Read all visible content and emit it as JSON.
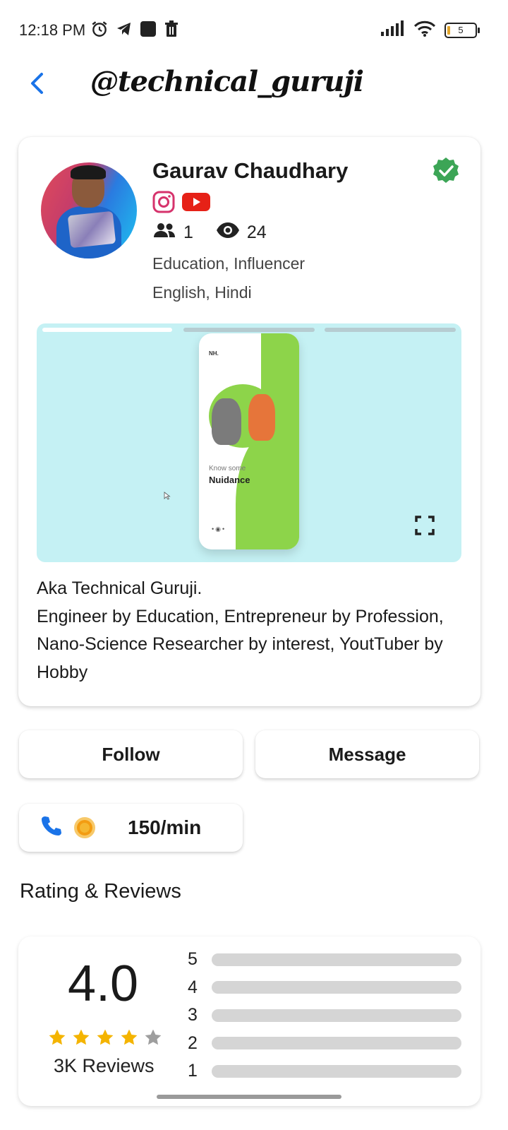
{
  "status_bar": {
    "time": "12:18 PM",
    "battery": "5"
  },
  "header": {
    "handle": "@technical_guruji"
  },
  "profile": {
    "name": "Gaurav Chaudhary",
    "followers": "1",
    "views": "24",
    "categories": "Education, Influencer",
    "languages": "English, Hindi",
    "bio": "Aka Technical Guruji.\nEngineer by Education, Entrepreneur by Profession, Nano-Science Researcher by interest, YoutTuber by Hobby",
    "media": {
      "slide_count": 3,
      "active_slide": 1,
      "preview_text_1": "Know some",
      "preview_text_2": "Nuidance",
      "preview_brand": "NH."
    }
  },
  "actions": {
    "follow_label": "Follow",
    "message_label": "Message",
    "call_rate": "150/min"
  },
  "ratings": {
    "section_title": "Rating & Reviews",
    "average": "4.0",
    "stars_filled": 4,
    "stars_total": 5,
    "reviews_label": "3K Reviews",
    "bars": [
      {
        "label": "5",
        "fill": 0
      },
      {
        "label": "4",
        "fill": 0
      },
      {
        "label": "3",
        "fill": 0
      },
      {
        "label": "2",
        "fill": 0
      },
      {
        "label": "1",
        "fill": 0
      }
    ]
  },
  "colors": {
    "accent_blue": "#1a73e8",
    "verified_green": "#3ca556",
    "instagram_pink": "#d6336c",
    "youtube_red": "#e62117",
    "star_gold": "#f4b400"
  }
}
